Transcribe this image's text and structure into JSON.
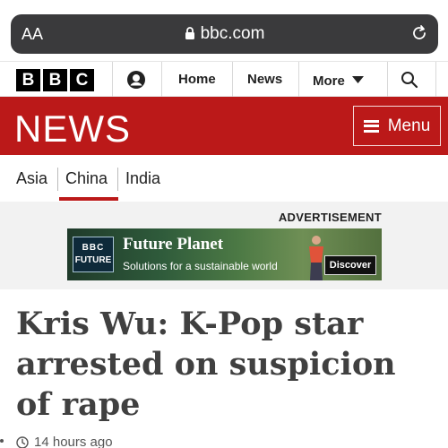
{
  "browser": {
    "text_size_label": "AA",
    "url": "bbc.com"
  },
  "masthead": {
    "logo_letters": [
      "B",
      "B",
      "C"
    ],
    "home_label": "Home",
    "news_label": "News",
    "more_label": "More"
  },
  "news_bar": {
    "logo_text": "NEWS",
    "menu_label": "Menu",
    "brand_color": "#bb1919"
  },
  "subnav": {
    "items": [
      {
        "label": "Asia",
        "active": false
      },
      {
        "label": "China",
        "active": true
      },
      {
        "label": "India",
        "active": false
      }
    ]
  },
  "advertisement": {
    "label": "ADVERTISEMENT",
    "logo_top": "BBC",
    "logo_bottom": "FUTURE",
    "title": "Future Planet",
    "subtitle": "Solutions for a sustainable world",
    "cta": "Discover"
  },
  "article": {
    "headline": "Kris Wu: K-Pop star arrested on suspicion of rape",
    "timestamp": "14 hours ago"
  }
}
